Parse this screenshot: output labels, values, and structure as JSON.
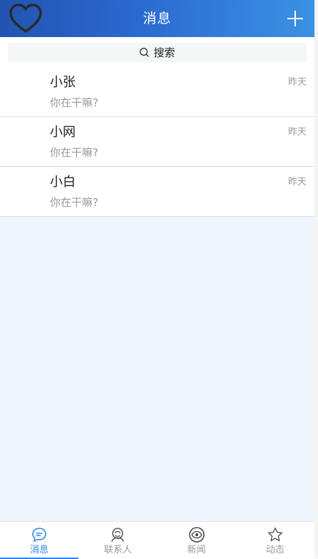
{
  "header": {
    "title": "消息",
    "left_icon": "heart-icon",
    "right_icon": "plus-icon"
  },
  "search": {
    "label": "搜索",
    "icon": "search-icon"
  },
  "chats": [
    {
      "name": "小张",
      "message": "你在干嘛?",
      "time": "昨天"
    },
    {
      "name": "小网",
      "message": "你在干嘛?",
      "time": "昨天"
    },
    {
      "name": "小白",
      "message": "你在干嘛?",
      "time": "昨天"
    }
  ],
  "tabbar": {
    "tabs": [
      {
        "label": "消息",
        "icon": "chat-bubble-icon",
        "active": true
      },
      {
        "label": "联系人",
        "icon": "contacts-icon",
        "active": false
      },
      {
        "label": "新闻",
        "icon": "eye-icon",
        "active": false
      },
      {
        "label": "动态",
        "icon": "star-icon",
        "active": false
      }
    ]
  },
  "colors": {
    "header_start": "#2254b0",
    "header_end": "#3a92e4",
    "accent": "#2a86e8",
    "page_background": "#eef5fd",
    "muted_text": "#9a9a9a"
  }
}
